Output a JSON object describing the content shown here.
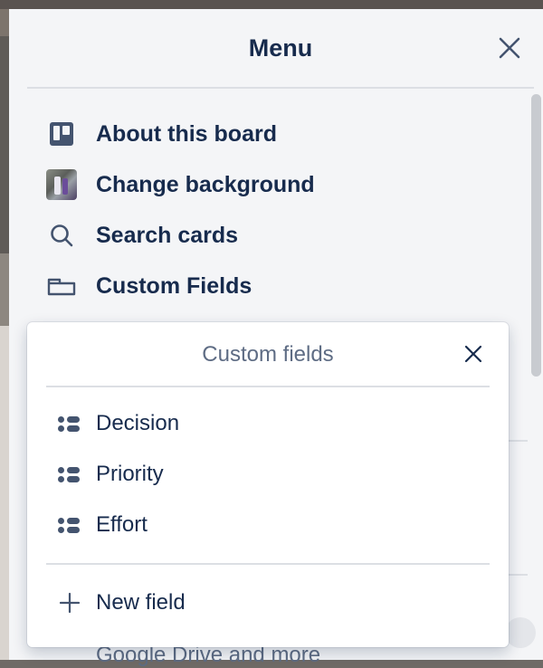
{
  "menu_panel": {
    "title": "Menu",
    "items": [
      {
        "label": "About this board",
        "icon": "board-icon"
      },
      {
        "label": "Change background",
        "icon": "background-thumbnail"
      },
      {
        "label": "Search cards",
        "icon": "search-icon"
      },
      {
        "label": "Custom Fields",
        "icon": "custom-fields-icon"
      }
    ],
    "partial_item": "Google Drive and more"
  },
  "custom_fields_popover": {
    "title": "Custom fields",
    "fields": [
      {
        "label": "Decision",
        "icon": "dropdown-field-icon"
      },
      {
        "label": "Priority",
        "icon": "dropdown-field-icon"
      },
      {
        "label": "Effort",
        "icon": "dropdown-field-icon"
      }
    ],
    "new_field_label": "New field"
  },
  "colors": {
    "text_primary": "#172b4d",
    "text_subtle": "#5e6c84",
    "panel_bg": "#f4f5f7",
    "icon": "#44546f"
  }
}
